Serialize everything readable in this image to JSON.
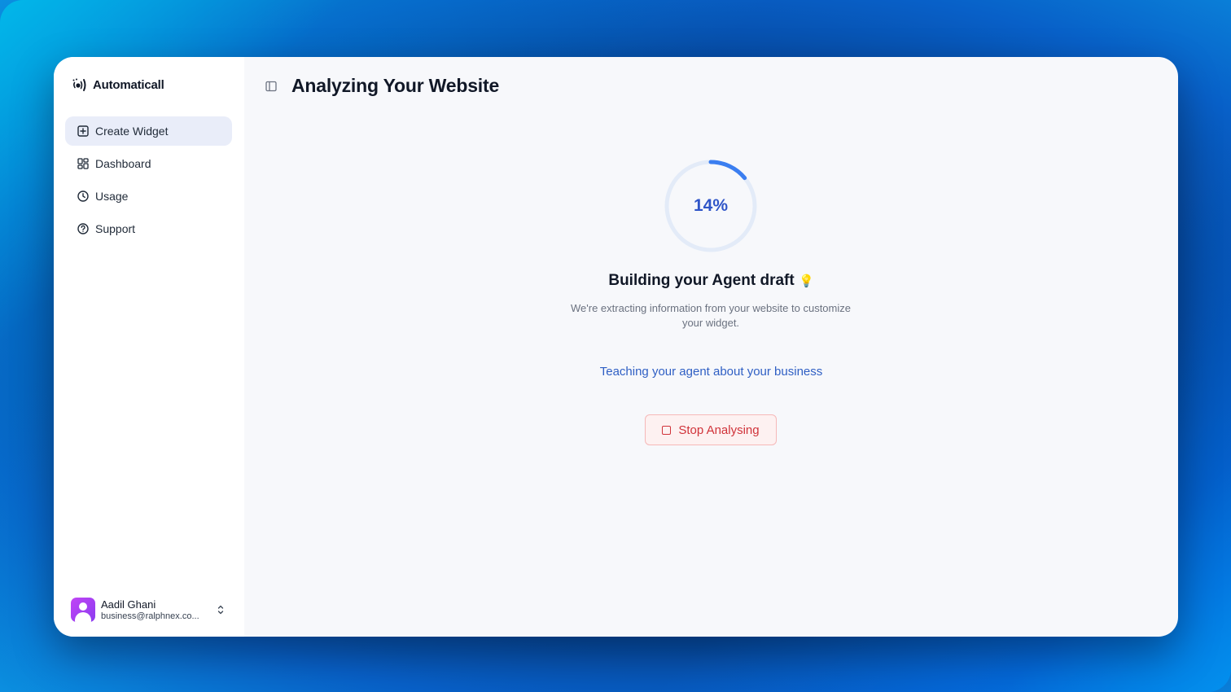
{
  "app": {
    "name": "Automaticall"
  },
  "sidebar": {
    "items": [
      {
        "label": "Create Widget",
        "icon": "plus-square-icon",
        "active": true
      },
      {
        "label": "Dashboard",
        "icon": "grid-icon",
        "active": false
      },
      {
        "label": "Usage",
        "icon": "clock-icon",
        "active": false
      },
      {
        "label": "Support",
        "icon": "help-circle-icon",
        "active": false
      }
    ],
    "user": {
      "name": "Aadil Ghani",
      "email": "business@ralphnex.co..."
    }
  },
  "main": {
    "title": "Analyzing Your Website",
    "progress": {
      "percent": 14,
      "label": "14%"
    },
    "heading": "Building your Agent draft",
    "heading_emoji": "💡",
    "description": "We're extracting information from your website to customize your widget.",
    "status": "Teaching your agent about your business",
    "stop_button_label": "Stop Analysing"
  },
  "colors": {
    "accent": "#2f55c8",
    "progress_track": "#e3ebf8",
    "progress_fill": "#3b7ef0",
    "danger": "#d0333a",
    "nav_active_bg": "#e9edf9"
  }
}
